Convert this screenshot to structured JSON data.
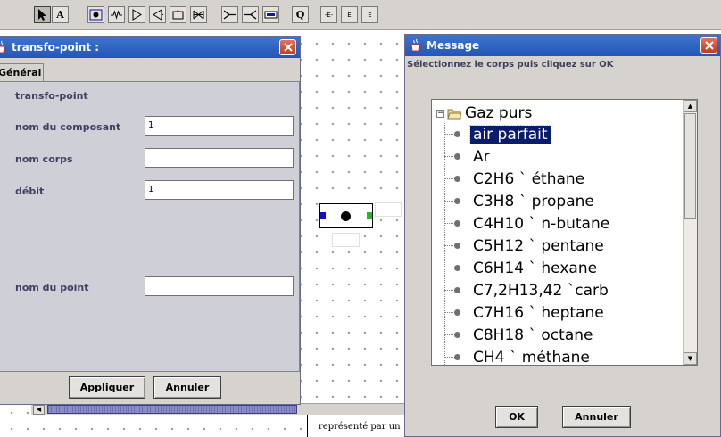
{
  "toolbar": {
    "tools": [
      {
        "icon": "pointer-arrow-icon"
      },
      {
        "icon": "text-tool-icon",
        "label": "A"
      },
      {
        "icon": "point-tool-icon"
      },
      {
        "icon": "flow-line-tool-icon"
      },
      {
        "icon": "compressor-tool-icon"
      },
      {
        "icon": "turbine-tool-icon"
      },
      {
        "icon": "combustion-tool-icon"
      },
      {
        "icon": "valve-tool-icon"
      },
      {
        "icon": "mixer-tool-icon"
      },
      {
        "icon": "divider-tool-icon"
      },
      {
        "icon": "exchanger-tool-icon"
      },
      {
        "icon": "heat-transfer-tool-icon",
        "label": "Q"
      },
      {
        "icon": "element-tool-icon",
        "label": "-E-"
      },
      {
        "icon": "external-in-tool-icon",
        "label": "E"
      },
      {
        "icon": "external-out-tool-icon",
        "label": "E"
      }
    ]
  },
  "canvas": {
    "footer_text": "représenté par un"
  },
  "transfo_dialog": {
    "title": "transfo-point :",
    "tab": "Général",
    "heading": "transfo-point",
    "fields": [
      {
        "label": "nom du composant",
        "value": "1"
      },
      {
        "label": "nom corps",
        "value": ""
      },
      {
        "label": "débit",
        "value": "1"
      },
      {
        "label": "nom du point",
        "value": ""
      }
    ],
    "apply_label": "Appliquer",
    "cancel_label": "Annuler"
  },
  "message_dialog": {
    "title": "Message",
    "instruction": "Sélectionnez le corps puis cliquez sur OK",
    "tree": {
      "root": "Gaz purs",
      "items": [
        "air parfait",
        "Ar",
        "C2H6 ` éthane",
        "C3H8 ` propane",
        "C4H10 ` n-butane",
        "C5H12 ` pentane",
        "C6H14 ` hexane",
        "C7,2H13,42 `carb",
        "C7H16 ` heptane",
        "C8H18 ` octane",
        "CH4 ` méthane"
      ],
      "selected": "air parfait"
    },
    "ok_label": "OK",
    "cancel_label": "Annuler"
  },
  "colors": {
    "titlebar": "#2a5fc0",
    "close_button": "#d04a2a",
    "selection": "#0a1c6e",
    "panel": "#cfcfd8",
    "port_in": "#1010c8",
    "port_out": "#22bb22"
  }
}
